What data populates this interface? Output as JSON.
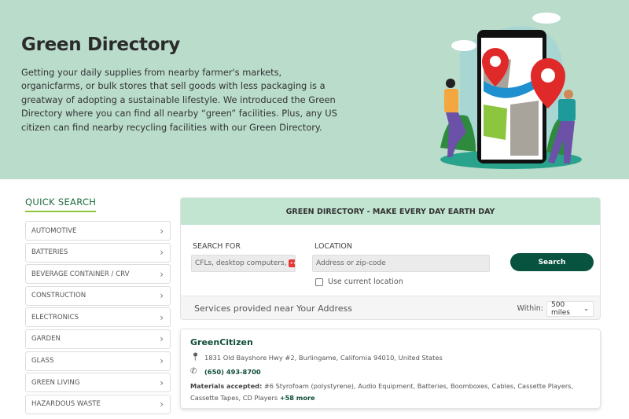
{
  "hero": {
    "title": "Green Directory",
    "description": "Getting your daily supplies from nearby farmer's markets, organicfarms, or bulk stores that sell goods with less packaging is a greatway of adopting a sustainable lifestyle. We introduced the Green Directory where you can find all nearby “green” facilities. Plus, any US citizen can find nearby recycling facilities with our Green Directory."
  },
  "quick_search": {
    "title": "QUICK SEARCH",
    "items": [
      {
        "label": "AUTOMOTIVE"
      },
      {
        "label": "BATTERIES"
      },
      {
        "label": "BEVERAGE CONTAINER / CRV"
      },
      {
        "label": "CONSTRUCTION"
      },
      {
        "label": "ELECTRONICS"
      },
      {
        "label": "GARDEN"
      },
      {
        "label": "GLASS"
      },
      {
        "label": "GREEN LIVING"
      },
      {
        "label": "HAZARDOUS WASTE"
      }
    ]
  },
  "search": {
    "header": "GREEN DIRECTORY - MAKE EVERY DAY EARTH DAY",
    "search_for_label": "SEARCH FOR",
    "search_for_value": "CFLs, desktop computers,",
    "badge": "•••",
    "badge_tail": "l",
    "location_label": "LOCATION",
    "location_placeholder": "Address or zip-code",
    "use_location": "Use current location",
    "button": "Search",
    "services_text": "Services provided near Your Address",
    "within_label": "Within:",
    "within_value": "500 miles"
  },
  "result": {
    "name": "GreenCitizen",
    "address": "1831 Old Bayshore Hwy #2, Burlingame, California 94010, United States",
    "phone": "(650) 493-8700",
    "materials_label": "Materials accepted:",
    "materials": " #6 Styrofoam (polystyrene), Audio Equipment, Batteries, Boomboxes, Cables, Cassette Players, Cassette Tapes, CD Players ",
    "more": "+58 more"
  },
  "colors": {
    "hero_bg": "#b9dccb",
    "accent": "#07533f",
    "panel_header": "#c2e5d1"
  }
}
